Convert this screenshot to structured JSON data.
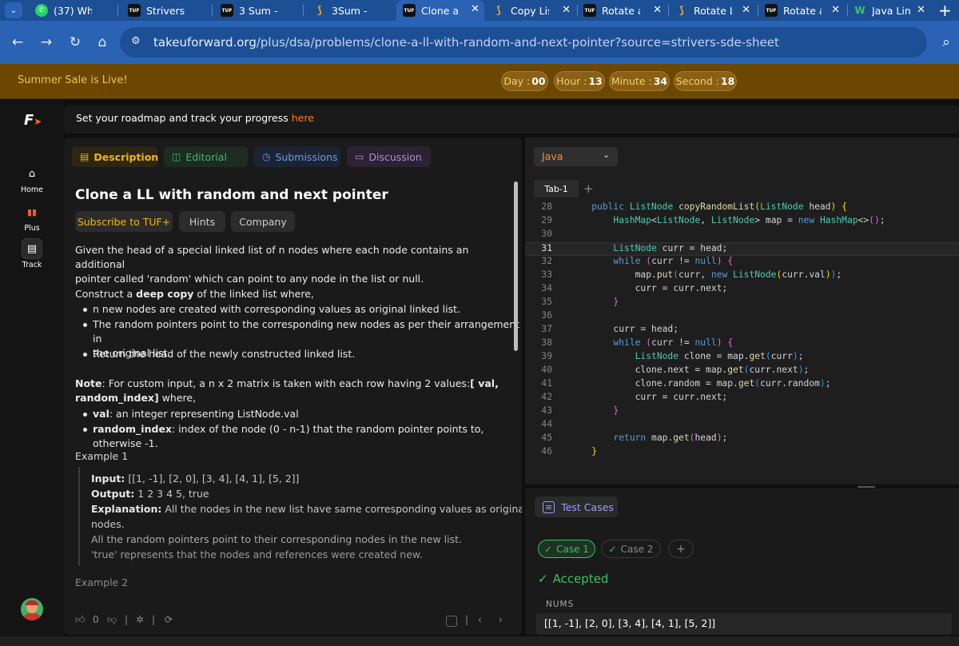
{
  "browser": {
    "tabs": [
      {
        "label": "(37) Wh",
        "favicon": "whatsapp-icon",
        "active": false
      },
      {
        "label": "Strivers",
        "favicon": "tuf-icon",
        "active": false
      },
      {
        "label": "3 Sum -",
        "favicon": "tuf-icon",
        "active": false
      },
      {
        "label": "3Sum -",
        "favicon": "leetcode-icon",
        "active": false
      },
      {
        "label": "Clone a",
        "favicon": "tuf-icon",
        "active": true
      },
      {
        "label": "Copy Lis",
        "favicon": "leetcode-icon",
        "active": false
      },
      {
        "label": "Rotate a",
        "favicon": "tuf-icon",
        "active": false
      },
      {
        "label": "Rotate L",
        "favicon": "leetcode-icon",
        "active": false
      },
      {
        "label": "Rotate a",
        "favicon": "tuf-icon",
        "active": false
      },
      {
        "label": "Java Lin",
        "favicon": "w-icon",
        "active": false
      }
    ],
    "url_host": "takeuforward.org",
    "url_path": "/plus/dsa/problems/clone-a-ll-with-random-and-next-pointer?source=strivers-sde-sheet"
  },
  "promo": {
    "text": "Summer Sale is Live!",
    "timers": [
      {
        "label": "Day :",
        "value": "00"
      },
      {
        "label": "Hour :",
        "value": "13"
      },
      {
        "label": "Minute :",
        "value": "34"
      },
      {
        "label": "Second :",
        "value": "18"
      }
    ]
  },
  "rail": {
    "home": "Home",
    "plus": "Plus",
    "track": "Track"
  },
  "roadmap": {
    "text": "Set your roadmap and track your progress ",
    "link": "here"
  },
  "problem_tabs": {
    "description": "Description",
    "editorial": "Editorial",
    "submissions": "Submissions",
    "discussion": "Discussion"
  },
  "problem": {
    "title": "Clone a LL with random and next pointer",
    "chips": {
      "subscribe": "Subscribe to TUF+",
      "hints": "Hints",
      "company": "Company"
    },
    "intro_1": "Given the head of a special linked list of n nodes where each node contains an additional",
    "intro_2": "pointer called 'random' which can point to any node in the list or null.",
    "construct_pre": "Construct a ",
    "construct_bold": "deep copy",
    "construct_post": " of the linked list where,",
    "bullet_1": "n new nodes are created with corresponding values as original linked list.",
    "bullet_2a": "The random pointers point to the corresponding new nodes as per their arrangement in",
    "bullet_2b": "the original list.",
    "bullet_3": "Return the head of the newly constructed linked list.",
    "note_label": "Note",
    "note_text_1": ": For custom input, a n x 2 matrix is taken with each row having 2 values:",
    "note_bold_1": "[ val,",
    "note_bold_2": "random_index]",
    "note_text_2": " where,",
    "val_label": "val",
    "val_text": ": an integer representing ListNode.val",
    "ri_label": "random_index",
    "ri_text": ": index of the node (0 - n-1) that the random pointer points to, otherwise -1.",
    "example1_title": "Example 1",
    "ex1_input_label": "Input:",
    "ex1_input": " [[1, -1], [2, 0], [3, 4], [4, 1], [5, 2]]",
    "ex1_output_label": "Output:",
    "ex1_output": " 1 2 3 4 5, true",
    "ex1_expl_label": "Explanation:",
    "ex1_expl_1": " All the nodes in the new list have same corresponding values as original",
    "ex1_expl_2": "nodes.",
    "ex1_expl_3": "All the random pointers point to their corresponding nodes in the new list.",
    "ex1_expl_4": "'true' represents that the nodes and references were created new.",
    "example2_title": "Example 2",
    "likes": "0"
  },
  "editor": {
    "language": "Java",
    "tab": "Tab-1",
    "lines": [
      {
        "n": "28",
        "html": "    <span class=\"kw\">public</span> <span class=\"ty\">ListNode</span> <span class=\"fn\">copyRandomList</span><span class=\"br\">(</span><span class=\"ty\">ListNode</span> head<span class=\"br\">)</span> <span class=\"br\">{</span>"
      },
      {
        "n": "29",
        "html": "        <span class=\"ty\">HashMap</span>&lt;<span class=\"ty\">ListNode</span>, <span class=\"ty\">ListNode</span>&gt; map = <span class=\"kw\">new</span> <span class=\"ty\">HashMap</span>&lt;&gt;<span class=\"br2\">()</span>;"
      },
      {
        "n": "30",
        "html": ""
      },
      {
        "n": "31",
        "html": "        <span class=\"ty\">ListNode</span> curr = head;",
        "current": true
      },
      {
        "n": "32",
        "html": "        <span class=\"kw\">while</span> <span class=\"br2\">(</span>curr != <span class=\"kw\">null</span><span class=\"br2\">)</span> <span class=\"br2\">{</span>"
      },
      {
        "n": "33",
        "html": "            map.<span class=\"fn\">put</span><span class=\"br3\">(</span>curr, <span class=\"kw\">new</span> <span class=\"ty\">ListNode</span><span class=\"br\">(</span>curr.val<span class=\"br\">)</span><span class=\"br3\">)</span>;"
      },
      {
        "n": "34",
        "html": "            curr = curr.next;"
      },
      {
        "n": "35",
        "html": "        <span class=\"br2\">}</span>"
      },
      {
        "n": "36",
        "html": ""
      },
      {
        "n": "37",
        "html": "        curr = head;"
      },
      {
        "n": "38",
        "html": "        <span class=\"kw\">while</span> <span class=\"br2\">(</span>curr != <span class=\"kw\">null</span><span class=\"br2\">)</span> <span class=\"br2\">{</span>"
      },
      {
        "n": "39",
        "html": "            <span class=\"ty\">ListNode</span> clone = map.<span class=\"fn\">get</span><span class=\"br3\">(</span>curr<span class=\"br3\">)</span>;"
      },
      {
        "n": "40",
        "html": "            clone.next = map.<span class=\"fn\">get</span><span class=\"br3\">(</span>curr.next<span class=\"br3\">)</span>;"
      },
      {
        "n": "41",
        "html": "            clone.random = map.<span class=\"fn\">get</span><span class=\"br3\">(</span>curr.random<span class=\"br3\">)</span>;"
      },
      {
        "n": "42",
        "html": "            curr = curr.next;"
      },
      {
        "n": "43",
        "html": "        <span class=\"br2\">}</span>"
      },
      {
        "n": "44",
        "html": ""
      },
      {
        "n": "45",
        "html": "        <span class=\"kw\">return</span> map.<span class=\"fn\">get</span><span class=\"br2\">(</span>head<span class=\"br2\">)</span>;"
      },
      {
        "n": "46",
        "html": "    <span class=\"br\">}</span>"
      }
    ]
  },
  "tests": {
    "tab": "Test Cases",
    "case1": "Case 1",
    "case2": "Case 2",
    "add": "+",
    "status": "Accepted",
    "nums_label": "NUMS",
    "nums_value": "[[1, -1], [2, 0], [3, 4], [4, 1], [5, 2]]"
  },
  "colors": {
    "accent": "#f5b50a",
    "accepted": "#3bc15c",
    "link": "#ff7a1a",
    "promo_bg": "#6c4702"
  }
}
